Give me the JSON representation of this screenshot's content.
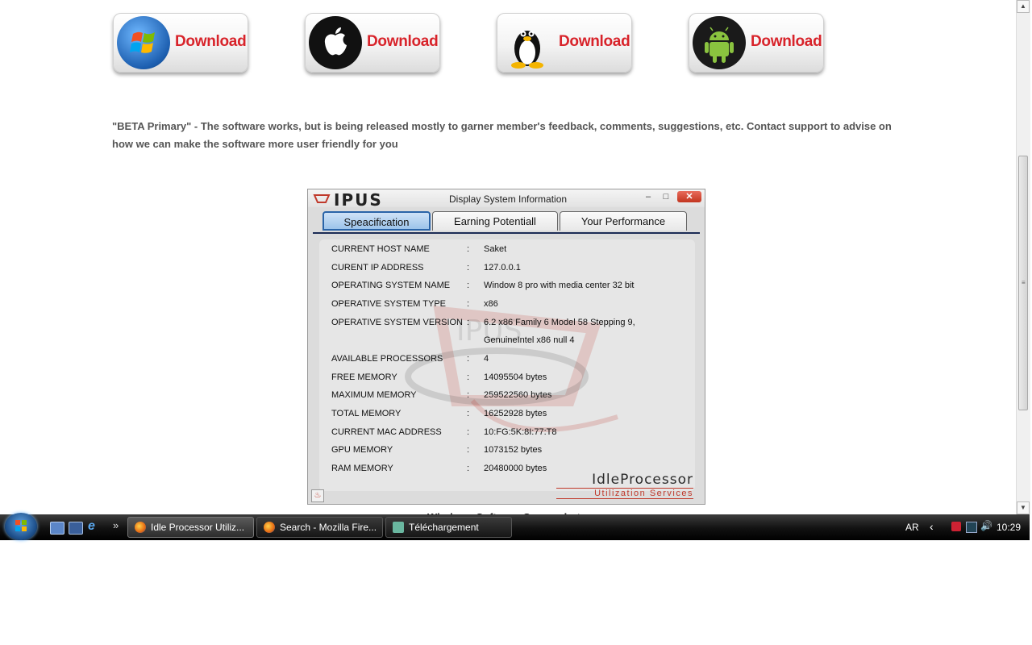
{
  "downloads": [
    {
      "os": "windows",
      "icon": "windows-logo-icon",
      "label": "Download"
    },
    {
      "os": "mac",
      "icon": "apple-logo-icon",
      "label": "Download"
    },
    {
      "os": "linux",
      "icon": "linux-penguin-icon",
      "label": "Download"
    },
    {
      "os": "android",
      "icon": "android-logo-icon",
      "label": "Download"
    }
  ],
  "beta_text": "\"BETA Primary\" - The software works, but is being released mostly to garner member's feedback, comments, suggestions, etc. Contact support to advise on how we can make the software more user friendly for you",
  "ipus_window": {
    "logo": "IPUS",
    "title": "Display System Information",
    "controls": {
      "minimize": "–",
      "maximize": "□",
      "close": "✕"
    },
    "tabs": [
      {
        "label": "Speacification",
        "active": true
      },
      {
        "label": "Earning Potentiall",
        "active": false
      },
      {
        "label": "Your Performance",
        "active": false
      }
    ],
    "watermark": "IPUS",
    "specs": [
      {
        "key": "CURRENT HOST NAME",
        "value": "Saket"
      },
      {
        "key": "CURENT IP ADDRESS",
        "value": "127.0.0.1"
      },
      {
        "key": "OPERATING SYSTEM NAME",
        "value": "Window 8 pro with media center 32 bit"
      },
      {
        "key": "OPERATIVE SYSTEM TYPE",
        "value": "x86"
      },
      {
        "key": "OPERATIVE SYSTEM VERSION",
        "value": "6.2 x86 Family 6 Model 58 Stepping 9,",
        "value2": "GenuineIntel x86 null 4"
      },
      {
        "key": "AVAILABLE PROCESSORS",
        "value": "4"
      },
      {
        "key": "FREE MEMORY",
        "value": "14095504 bytes"
      },
      {
        "key": "MAXIMUM MEMORY",
        "value": "259522560 bytes"
      },
      {
        "key": "TOTAL MEMORY",
        "value": "16252928 bytes"
      },
      {
        "key": "CURRENT MAC ADDRESS",
        "value": "10:FG:5K:8I:77:T8"
      },
      {
        "key": "GPU MEMORY",
        "value": "1073152 bytes"
      },
      {
        "key": "RAM MEMORY",
        "value": "20480000 bytes"
      }
    ],
    "separator": ":",
    "brand_line1": "IdleProcessor",
    "brand_line2": "Utilization Services"
  },
  "cut_caption": "Windows Software Screenshot",
  "taskbar": {
    "quicklaunch_more": "»",
    "tasks": [
      {
        "label": "Idle Processor Utiliz...",
        "icon": "firefox-icon",
        "active": true
      },
      {
        "label": "Search - Mozilla Fire...",
        "icon": "firefox-icon",
        "active": false
      },
      {
        "label": "Téléchargement",
        "icon": "folder-icon",
        "active": false
      }
    ],
    "language": "AR",
    "clock": "10:29"
  },
  "colors": {
    "download_red": "#d8232a",
    "tab_active_border": "#2a64a8",
    "brand_red": "#c0392b"
  }
}
